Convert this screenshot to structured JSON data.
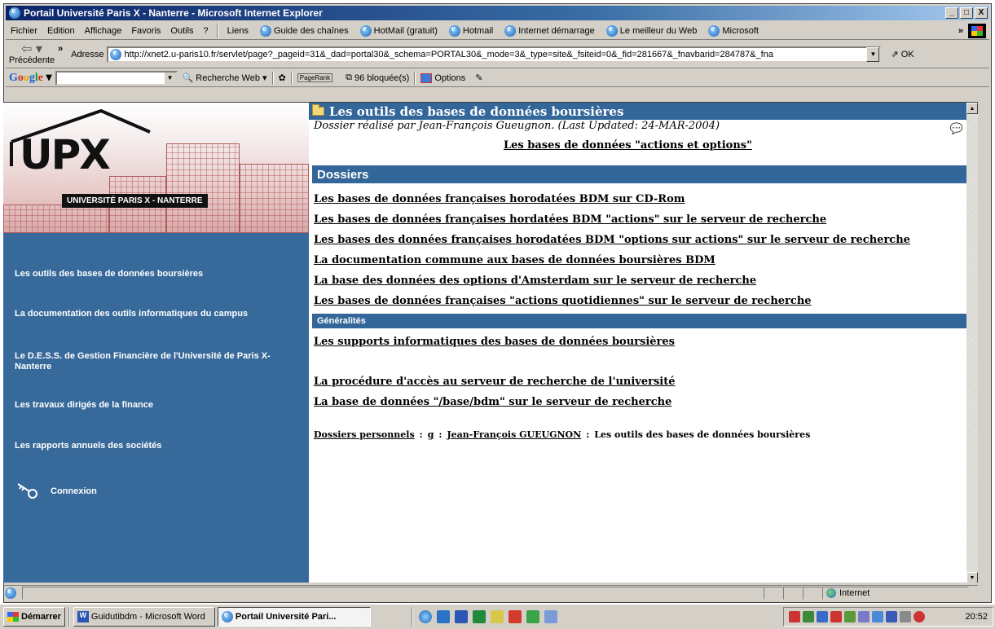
{
  "window": {
    "title": "Portail Université Paris X - Nanterre - Microsoft Internet Explorer",
    "controls": [
      "_",
      "□",
      "X"
    ]
  },
  "menu": {
    "items": [
      "Fichier",
      "Edition",
      "Affichage",
      "Favoris",
      "Outils",
      "?"
    ],
    "links_label": "Liens",
    "links": [
      "Guide des chaînes",
      "HotMail (gratuit)",
      "Hotmail",
      "Internet démarrage",
      "Le meilleur du Web",
      "Microsoft"
    ],
    "more": "»"
  },
  "address": {
    "back_label": "Précédente",
    "more": "»",
    "label": "Adresse",
    "url": "http://xnet2.u-paris10.fr/servlet/page?_pageid=31&_dad=portal30&_schema=PORTAL30&_mode=3&_type=site&_fsiteid=0&_fid=281667&_fnavbarid=284787&_fna",
    "go": "OK"
  },
  "google": {
    "logo": [
      "G",
      "o",
      "o",
      "g",
      "l",
      "e"
    ],
    "search_web": "Recherche Web",
    "pagerank": "PageRank",
    "blocked": "96 bloquée(s)",
    "options": "Options"
  },
  "sidebar": {
    "logo_text": "UPX",
    "university_label": "UNIVERSITÉ PARIS X - NANTERRE",
    "nav": [
      "Les outils des bases de données boursières",
      "La documentation des outils informatiques du campus",
      "Le D.E.S.S. de Gestion Financière de l'Université de Paris X-Nanterre",
      "Les travaux dirigés de la finance",
      "Les rapports annuels des sociétés"
    ],
    "connexion": "Connexion"
  },
  "main": {
    "title": "Les outils des bases de données boursières",
    "subtitle": "Dossier réalisé par Jean-François Gueugnon. (Last Updated: 24-MAR-2004)",
    "top_link": "Les bases de données \"actions et options\"",
    "dossiers_header": "Dossiers",
    "dossiers": [
      "Les bases de données françaises horodatées BDM sur CD-Rom",
      "Les bases de données françaises hordatées BDM \"actions\" sur le serveur de recherche",
      "Les bases des données françaises horodatées BDM \"options sur actions\" sur le serveur de recherche",
      "La documentation commune aux bases de données boursières BDM",
      "La base des données des options d'Amsterdam sur le serveur de recherche",
      "Les bases de données françaises \"actions quotidiennes\" sur le serveur de recherche"
    ],
    "generalites_header": "Généralités",
    "generalites": [
      "Les supports informatiques des bases de données boursières",
      "La procédure d'accès au serveur de recherche de l'université",
      "La base de données \"/base/bdm\" sur le serveur de recherche"
    ],
    "breadcrumb": [
      "Dossiers personnels",
      ":",
      "g",
      ":",
      "Jean-François GUEUGNON",
      ":",
      "Les outils des bases de données boursières"
    ]
  },
  "statusbar": {
    "zone": "Internet"
  },
  "taskbar": {
    "start": "Démarrer",
    "tasks": [
      "Guidutibdm - Microsoft Word",
      "Portail Université Pari..."
    ],
    "clock": "20:52"
  }
}
